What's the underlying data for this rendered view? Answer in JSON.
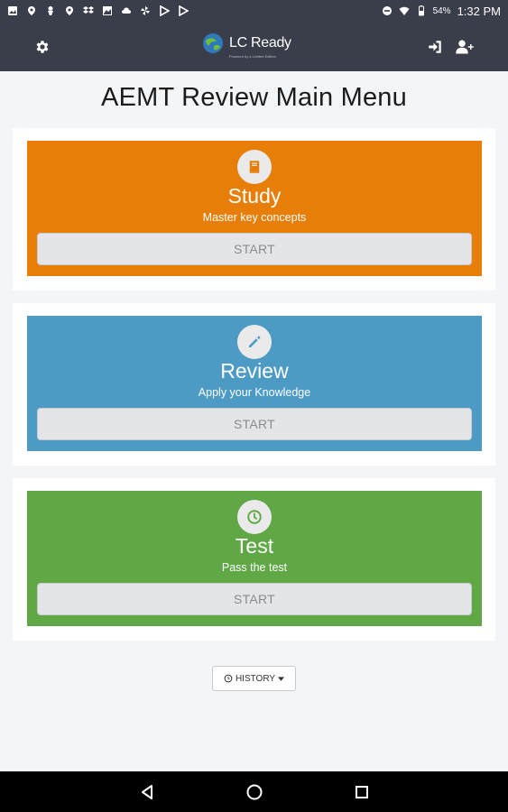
{
  "status_bar": {
    "notification_icons": [
      "image-icon",
      "location-pin-icon",
      "person-pin-icon",
      "location-pin-icon",
      "dropbox-icon",
      "photo-icon",
      "cloud-icon",
      "pinwheel-icon",
      "play-store-icon",
      "play-store-icon"
    ],
    "battery": "54%",
    "time": "1:32 PM"
  },
  "app_bar": {
    "logo_text": "LC Ready",
    "logo_subtext": "Powered by a Limited Edition"
  },
  "page": {
    "title": "AEMT Review Main Menu"
  },
  "cards": [
    {
      "title": "Study",
      "subtitle": "Master key concepts",
      "button": "START",
      "color": "#e67e07",
      "icon": "book-icon"
    },
    {
      "title": "Review",
      "subtitle": "Apply your Knowledge",
      "button": "START",
      "color": "#4d9bc5",
      "icon": "pencil-icon"
    },
    {
      "title": "Test",
      "subtitle": "Pass the test",
      "button": "START",
      "color": "#5fa845",
      "icon": "clock-icon"
    }
  ],
  "history_button": {
    "label": "HISTORY"
  },
  "colors": {
    "appbar": "#3a3d4a",
    "background": "#f4f5f7"
  }
}
